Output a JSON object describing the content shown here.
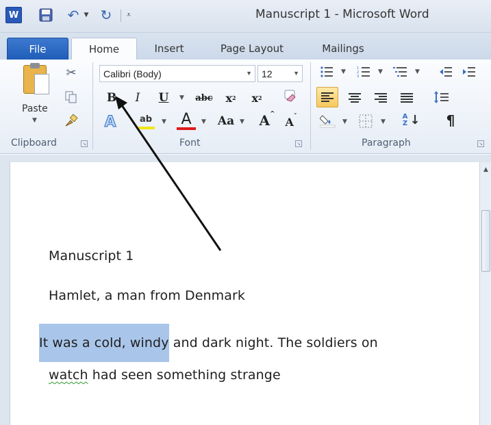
{
  "titlebar": {
    "app_icon_letter": "W",
    "title": "Manuscript 1  -  Microsoft Word"
  },
  "tabs": [
    {
      "label": "File"
    },
    {
      "label": "Home",
      "active": true
    },
    {
      "label": "Insert"
    },
    {
      "label": "Page Layout"
    },
    {
      "label": "Mailings"
    }
  ],
  "clipboard": {
    "paste_label": "Paste",
    "group_label": "Clipboard"
  },
  "font": {
    "font_name": "Calibri (Body)",
    "font_size": "12",
    "bold": "B",
    "italic": "I",
    "underline": "U",
    "strikethrough": "abc",
    "subscript": "x",
    "subscript_mark": "2",
    "superscript": "x",
    "superscript_mark": "2",
    "change_case": "Aa",
    "grow": "A",
    "shrink": "A",
    "font_color_letter": "A",
    "highlight_letters": "ab",
    "group_label": "Font"
  },
  "paragraph": {
    "group_label": "Paragraph",
    "sort_letters": "A Z",
    "pilcrow": "¶"
  },
  "colors": {
    "selection": "#a9c6ea",
    "highlight_yellow": "#f2e618",
    "font_color_red": "#e01b1b",
    "file_tab": "#2c6ac4"
  },
  "document": {
    "line1": "Manuscript 1",
    "line2": "Hamlet, a man from Denmark",
    "line3_selected": "It was a cold, windy",
    "line3_rest": " and dark night. The soldiers on",
    "line4_misspelled": "watch",
    "line4_rest": " had seen something strange"
  }
}
